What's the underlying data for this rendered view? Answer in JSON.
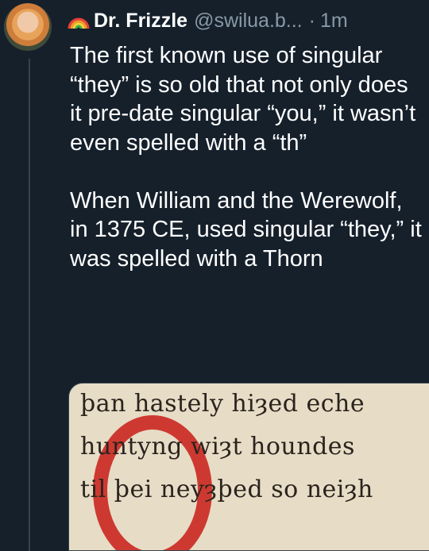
{
  "tweet": {
    "author_name": "Dr. Frizzle",
    "handle": "@swilua.b...",
    "separator": "·",
    "time": "1m",
    "paragraphs": [
      "The first known use of singular “they” is so old that not only does it pre-date singular “you,” it wasn’t even spelled with a “th”",
      "When William and the Werewolf, in 1375 CE, used singular “they,” it was spelled with a Thorn"
    ]
  },
  "media": {
    "lines": [
      "þan hastely hiȝed eche",
      "huntyng wiȝt houndes",
      "til þei neyȝþed so neiȝh"
    ]
  },
  "colors": {
    "background": "#15202b",
    "secondary_text": "#8899a6",
    "highlight_circle": "#c81c16"
  },
  "icons": [
    "rainbow-icon"
  ]
}
